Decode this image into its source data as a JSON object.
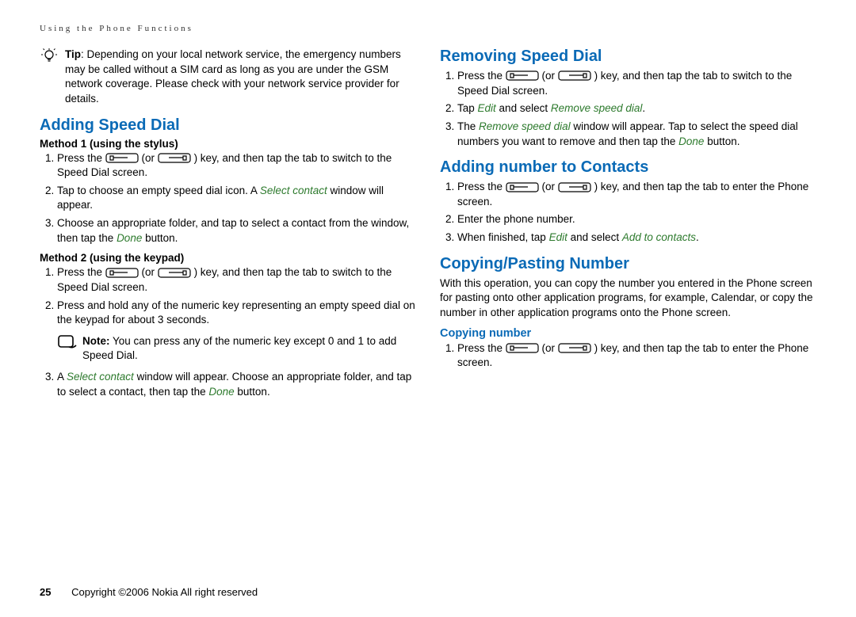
{
  "header": "Using the Phone Functions",
  "tip": {
    "label": "Tip",
    "text": ": Depending on your local network service, the emergency numbers may be called without a SIM card as long as you are under the GSM network coverage. Please check with your network service provider for details."
  },
  "addingSpeedDial": {
    "heading": "Adding Speed Dial",
    "method1": {
      "title": "Method 1 (using the stylus)",
      "step1a": "Press the ",
      "step1b": " (or ",
      "step1c": ") key, and then tap the tab to switch to the Speed Dial screen.",
      "step2a": "Tap to choose an empty speed dial icon. A ",
      "step2b": "Select contact",
      "step2c": " window will appear.",
      "step3a": "Choose an appropriate folder, and tap to select a contact from the window, then tap the ",
      "step3b": "Done",
      "step3c": " button."
    },
    "method2": {
      "title": "Method 2 (using the keypad)",
      "step1a": "Press the ",
      "step1b": " (or ",
      "step1c": ") key, and then tap the tab to switch to the Speed Dial screen.",
      "step2": "Press and hold any of the numeric key representing an empty speed dial on the keypad for about 3 seconds.",
      "noteLabel": "Note:",
      "noteText": " You can press any of the numeric key except 0 and 1 to add Speed Dial.",
      "step3a": "A ",
      "step3b": "Select contact",
      "step3c": " window will appear. Choose an appropriate folder, and tap to select a contact, then tap the ",
      "step3d": "Done",
      "step3e": " button."
    }
  },
  "removingSpeedDial": {
    "heading": "Removing Speed Dial",
    "step1a": "Press the ",
    "step1b": " (or ",
    "step1c": ") key, and then tap the tab to switch to the Speed Dial screen.",
    "step2a": "Tap ",
    "step2b": "Edit",
    "step2c": " and select ",
    "step2d": "Remove speed dial",
    "step2e": ".",
    "step3a": "The ",
    "step3b": "Remove speed dial",
    "step3c": " window will appear. Tap to select the speed dial numbers you want to remove and then tap the ",
    "step3d": "Done",
    "step3e": " button."
  },
  "addingNumber": {
    "heading": "Adding number to Contacts",
    "step1a": "Press the ",
    "step1b": " (or ",
    "step1c": ") key, and then tap the tab to enter the Phone screen.",
    "step2": "Enter the phone number.",
    "step3a": "When finished, tap ",
    "step3b": "Edit",
    "step3c": " and select ",
    "step3d": "Add to contacts",
    "step3e": "."
  },
  "copyPaste": {
    "heading": "Copying/Pasting Number",
    "intro": "With this operation, you can copy the number you entered in the Phone screen for pasting onto other application programs, for example, Calendar, or copy the number in other application programs onto the Phone screen.",
    "copyHeading": "Copying number",
    "step1a": "Press the ",
    "step1b": " (or ",
    "step1c": ") key, and then tap the tab to enter the Phone screen."
  },
  "footer": {
    "page": "25",
    "copyright": "Copyright ©2006 Nokia All right reserved"
  }
}
